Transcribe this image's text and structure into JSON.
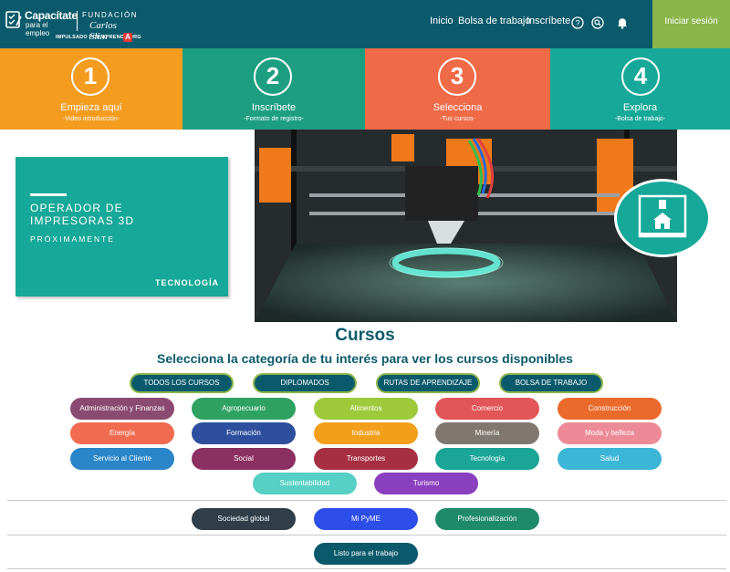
{
  "header": {
    "logo": {
      "title": "Capacítate",
      "subtitle": "para el empleo",
      "fundacion": "FUNDACIÓN",
      "carlos": "Carlos Slim",
      "impulsado": "IMPULSADO POR APRENDE.ORG",
      "badge": "A"
    },
    "nav": [
      {
        "label": "Inicio"
      },
      {
        "label": "Bolsa de trabajo"
      },
      {
        "label": "Inscríbete"
      }
    ],
    "icons": [
      "help-icon",
      "search-icon",
      "bell-icon"
    ],
    "login_label": "Iniciar sesión",
    "colors": {
      "header": "#0b5a6b",
      "login": "#8ab54a"
    }
  },
  "steps": [
    {
      "number": "1",
      "title": "Empieza aquí",
      "subtitle": "-Video introducción-",
      "color": "#f39c1f"
    },
    {
      "number": "2",
      "title": "Inscríbete",
      "subtitle": "-Formato de registro-",
      "color": "#1e9e80"
    },
    {
      "number": "3",
      "title": "Selecciona",
      "subtitle": "-Tus cursos-",
      "color": "#ef6a47"
    },
    {
      "number": "4",
      "title": "Explora",
      "subtitle": "-Bolsa de trabajo-",
      "color": "#16a898"
    }
  ],
  "banner": {
    "title_line1": "OPERADOR DE",
    "title_line2": "IMPRESORAS 3D",
    "soon": "PRÓXIMAMENTE",
    "category": "TECNOLOGÍA"
  },
  "cursos": {
    "title": "Cursos",
    "subtitle": "Selecciona la categoría de tu interés para ver los cursos disponibles",
    "top_tabs": [
      {
        "label": "TODOS LOS CURSOS"
      },
      {
        "label": "DIPLOMADOS"
      },
      {
        "label": "RUTAS DE APRENDIZAJE"
      },
      {
        "label": "BOLSA DE TRABAJO"
      }
    ],
    "categories": [
      {
        "label": "Administración y Finanzas",
        "color": "#8a4a72"
      },
      {
        "label": "Agropecuario",
        "color": "#2fa262"
      },
      {
        "label": "Alimentos",
        "color": "#9dc93b"
      },
      {
        "label": "Comercio",
        "color": "#e25558"
      },
      {
        "label": "Construcción",
        "color": "#ea6a2c"
      },
      {
        "label": "Energía",
        "color": "#f06b4f"
      },
      {
        "label": "Formación",
        "color": "#2e4f9e"
      },
      {
        "label": "Industria",
        "color": "#f2a01c"
      },
      {
        "label": "Minería",
        "color": "#7f7770"
      },
      {
        "label": "Moda y belleza",
        "color": "#ec8b97"
      },
      {
        "label": "Servicio al Cliente",
        "color": "#2a86c8"
      },
      {
        "label": "Social",
        "color": "#8c2f62"
      },
      {
        "label": "Transportes",
        "color": "#a63042"
      },
      {
        "label": "Tecnología",
        "color": "#1aa597"
      },
      {
        "label": "Salud",
        "color": "#3cb6d6"
      },
      {
        "label": "Sustentabilidad",
        "color": "#56cfc4"
      },
      {
        "label": "Turismo",
        "color": "#8a3fbf"
      }
    ],
    "extra": [
      {
        "label": "Sociedad global",
        "color": "#2f3e48"
      },
      {
        "label": "Mi PyME",
        "color": "#2d4ee8"
      },
      {
        "label": "Profesionalización",
        "color": "#1e8a6a"
      }
    ],
    "listo": {
      "label": "Listo para el trabajo",
      "color": "#0b5a6b"
    }
  }
}
